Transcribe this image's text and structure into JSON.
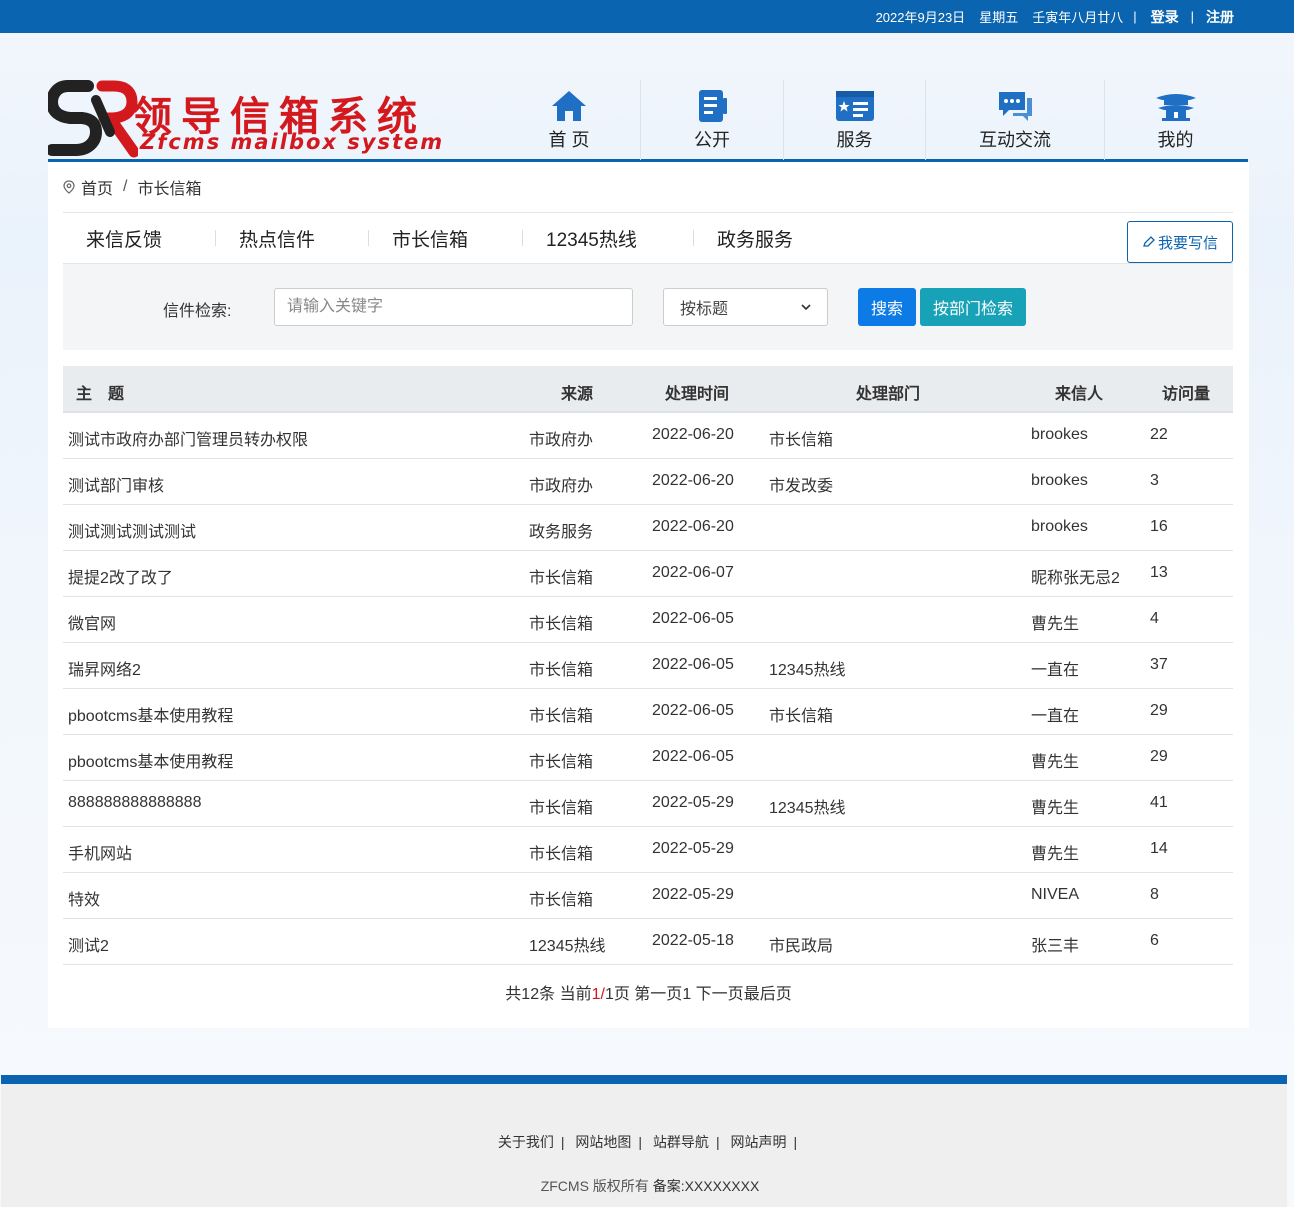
{
  "topbar": {
    "date": "2022年9月23日",
    "weekday": "星期五",
    "lunar": "壬寅年八月廿八",
    "login": "登录",
    "register": "注册"
  },
  "logo": {
    "cn": "领导信箱系统",
    "en": "Zfcms mailbox system"
  },
  "nav": [
    {
      "label": "首 页",
      "icon": "home-icon"
    },
    {
      "label": "公开",
      "icon": "notebook-icon"
    },
    {
      "label": "服务",
      "icon": "id-card-icon"
    },
    {
      "label": "互动交流",
      "icon": "chat-icon"
    },
    {
      "label": "我的",
      "icon": "pavilion-icon"
    }
  ],
  "breadcrumb": {
    "home": "首页",
    "current": "市长信箱"
  },
  "tabs": [
    "来信反馈",
    "热点信件",
    "市长信箱",
    "12345热线",
    "政务服务"
  ],
  "write_button": "我要写信",
  "search": {
    "label": "信件检索:",
    "placeholder": "请输入关键字",
    "select_value": "按标题",
    "search_button": "搜索",
    "dept_button": "按部门检索"
  },
  "table": {
    "headers": {
      "subject": "主　题",
      "source": "来源",
      "time": "处理时间",
      "dept": "处理部门",
      "sender": "来信人",
      "views": "访问量"
    },
    "rows": [
      {
        "subject": "测试市政府办部门管理员转办权限",
        "source": "市政府办",
        "time": "2022-06-20",
        "dept": "市长信箱",
        "sender": "brookes",
        "views": "22"
      },
      {
        "subject": "测试部门审核",
        "source": "市政府办",
        "time": "2022-06-20",
        "dept": "市发改委",
        "sender": "brookes",
        "views": "3"
      },
      {
        "subject": "测试测试测试测试",
        "source": "政务服务",
        "time": "2022-06-20",
        "dept": "",
        "sender": "brookes",
        "views": "16"
      },
      {
        "subject": "提提2改了改了",
        "source": "市长信箱",
        "time": "2022-06-07",
        "dept": "",
        "sender": "昵称张无忌2",
        "views": "13"
      },
      {
        "subject": "微官网",
        "source": "市长信箱",
        "time": "2022-06-05",
        "dept": "",
        "sender": "曹先生",
        "views": "4"
      },
      {
        "subject": "瑞昇网络2",
        "source": "市长信箱",
        "time": "2022-06-05",
        "dept": "12345热线",
        "sender": "一直在",
        "views": "37"
      },
      {
        "subject": "pbootcms基本使用教程",
        "source": "市长信箱",
        "time": "2022-06-05",
        "dept": "市长信箱",
        "sender": "一直在",
        "views": "29"
      },
      {
        "subject": "pbootcms基本使用教程",
        "source": "市长信箱",
        "time": "2022-06-05",
        "dept": "",
        "sender": "曹先生",
        "views": "29"
      },
      {
        "subject": "888888888888888",
        "source": "市长信箱",
        "time": "2022-05-29",
        "dept": "12345热线",
        "sender": "曹先生",
        "views": "41"
      },
      {
        "subject": "手机网站",
        "source": "市长信箱",
        "time": "2022-05-29",
        "dept": "",
        "sender": "曹先生",
        "views": "14"
      },
      {
        "subject": "特效",
        "source": "市长信箱",
        "time": "2022-05-29",
        "dept": "",
        "sender": "NIVEA",
        "views": "8"
      },
      {
        "subject": "测试2",
        "source": "12345热线",
        "time": "2022-05-18",
        "dept": "市民政局",
        "sender": "张三丰",
        "views": "6"
      }
    ]
  },
  "pager": {
    "total": "共12条",
    "current_prefix": "当前",
    "current_page": "1",
    "slash": "/",
    "page_total": "1页",
    "first": "第一页",
    "page_num": "1",
    "next": "下一页",
    "last": "最后页"
  },
  "footer": {
    "links": [
      "关于我们",
      "网站地图",
      "站群导航",
      "网站声明"
    ],
    "copyright": "ZFCMS 版权所有",
    "record_label": "备案:",
    "record_value": "XXXXXXXX"
  },
  "colors": {
    "primary": "#0a64b0",
    "brand_red": "#d3181e",
    "search_btn": "#0d7be6",
    "dept_btn": "#18a2b8"
  }
}
